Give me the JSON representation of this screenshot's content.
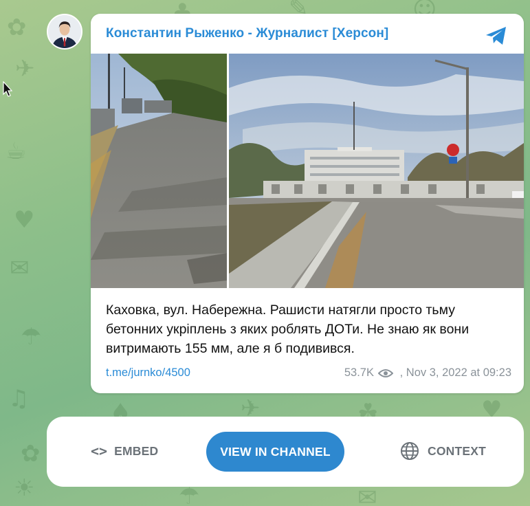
{
  "channel": {
    "name": "Константин Рыженко - Журналист [Херсон]",
    "avatar_icon": "person-portrait-avatar",
    "brand_color": "#2a8bd6"
  },
  "post": {
    "photos": [
      {
        "icon": "embankment-walkway-photo"
      },
      {
        "icon": "concrete-fortifications-photo"
      }
    ],
    "caption": "Каховка, вул. Набережна. Рашисти натягли просто тьму бетонних укріплень з яких роблять ДОТи. Не знаю як вони витримають 155 мм, але я б подивився.",
    "link_text": "t.me/jurnko/4500",
    "views": "53.7K",
    "date": ", Nov 3, 2022 at 09:23"
  },
  "actions": {
    "embed_icon": "<>",
    "embed_label": "EMBED",
    "view_label": "VIEW IN CHANNEL",
    "context_label": "CONTEXT",
    "accent_color": "#2e88cf"
  }
}
